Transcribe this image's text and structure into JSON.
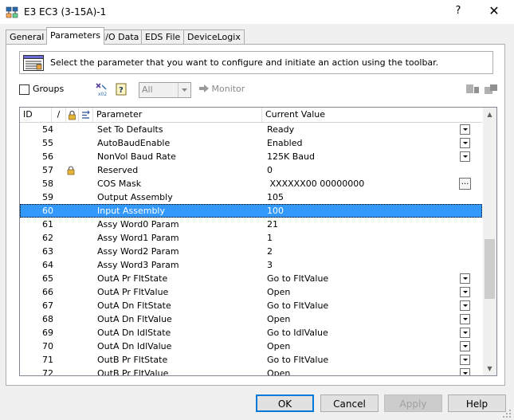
{
  "window": {
    "title": "E3 EC3 (3-15A)-1",
    "help_label": "?",
    "close_label": "✕"
  },
  "tabs": [
    {
      "label": "General",
      "active": false
    },
    {
      "label": "Parameters",
      "active": true
    },
    {
      "label": "I/O Data",
      "active": false
    },
    {
      "label": "EDS File",
      "active": false
    },
    {
      "label": "DeviceLogix",
      "active": false
    }
  ],
  "instructions": "Select the parameter that you want to configure and initiate an action using the toolbar.",
  "toolbar": {
    "groups_label": "Groups",
    "groups_checked": false,
    "filter_value": "All",
    "monitor_label": "Monitor"
  },
  "grid": {
    "headers": {
      "id": "ID",
      "sort": "/",
      "param": "Parameter",
      "value": "Current Value"
    },
    "rows": [
      {
        "id": "54",
        "param": "Set To Defaults",
        "value": "Ready",
        "control": "dropdown",
        "locked": false,
        "selected": false
      },
      {
        "id": "55",
        "param": "AutoBaudEnable",
        "value": "Enabled",
        "control": "dropdown",
        "locked": false,
        "selected": false
      },
      {
        "id": "56",
        "param": "NonVol Baud Rate",
        "value": "125K Baud",
        "control": "dropdown",
        "locked": false,
        "selected": false
      },
      {
        "id": "57",
        "param": "Reserved",
        "value": "0",
        "control": "",
        "locked": true,
        "selected": false
      },
      {
        "id": "58",
        "param": "COS Mask",
        "value": " XXXXXX00 00000000",
        "control": "ellipsis",
        "locked": false,
        "selected": false
      },
      {
        "id": "59",
        "param": "Output Assembly",
        "value": "105",
        "control": "",
        "locked": false,
        "selected": false
      },
      {
        "id": "60",
        "param": "Input Assembly",
        "value": "100",
        "control": "",
        "locked": false,
        "selected": true
      },
      {
        "id": "61",
        "param": "Assy Word0 Param",
        "value": "21",
        "control": "",
        "locked": false,
        "selected": false
      },
      {
        "id": "62",
        "param": "Assy Word1 Param",
        "value": "1",
        "control": "",
        "locked": false,
        "selected": false
      },
      {
        "id": "63",
        "param": "Assy Word2 Param",
        "value": "2",
        "control": "",
        "locked": false,
        "selected": false
      },
      {
        "id": "64",
        "param": "Assy Word3 Param",
        "value": "3",
        "control": "",
        "locked": false,
        "selected": false
      },
      {
        "id": "65",
        "param": "OutA Pr FltState",
        "value": "Go to FltValue",
        "control": "dropdown",
        "locked": false,
        "selected": false
      },
      {
        "id": "66",
        "param": "OutA Pr FltValue",
        "value": "Open",
        "control": "dropdown",
        "locked": false,
        "selected": false
      },
      {
        "id": "67",
        "param": "OutA Dn FltState",
        "value": "Go to FltValue",
        "control": "dropdown",
        "locked": false,
        "selected": false
      },
      {
        "id": "68",
        "param": "OutA Dn FltValue",
        "value": "Open",
        "control": "dropdown",
        "locked": false,
        "selected": false
      },
      {
        "id": "69",
        "param": "OutA Dn IdlState",
        "value": "Go to IdlValue",
        "control": "dropdown",
        "locked": false,
        "selected": false
      },
      {
        "id": "70",
        "param": "OutA Dn IdlValue",
        "value": "Open",
        "control": "dropdown",
        "locked": false,
        "selected": false
      },
      {
        "id": "71",
        "param": "OutB Pr FltState",
        "value": "Go to FltValue",
        "control": "dropdown",
        "locked": false,
        "selected": false
      },
      {
        "id": "72",
        "param": "OutB Pr FltValue",
        "value": "Open",
        "control": "dropdown",
        "locked": false,
        "selected": false
      }
    ]
  },
  "buttons": {
    "ok": "OK",
    "cancel": "Cancel",
    "apply": "Apply",
    "help": "Help"
  },
  "colors": {
    "selection": "#3399ff",
    "default_button_border": "#0078d7"
  }
}
